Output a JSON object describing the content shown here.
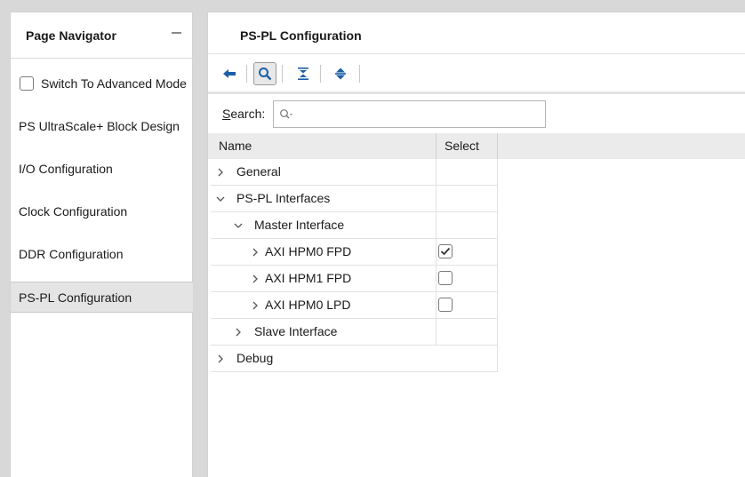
{
  "navigator": {
    "title": "Page Navigator",
    "advanced_mode_label": "Switch To Advanced Mode",
    "advanced_mode_checked": false,
    "items": [
      {
        "label": "PS UltraScale+ Block Design",
        "selected": false
      },
      {
        "label": "I/O Configuration",
        "selected": false
      },
      {
        "label": "Clock Configuration",
        "selected": false
      },
      {
        "label": "DDR Configuration",
        "selected": false
      },
      {
        "label": "PS-PL Configuration",
        "selected": true
      }
    ]
  },
  "main": {
    "title": "PS-PL Configuration",
    "toolbar": {
      "icons": [
        "back-arrow-icon",
        "search-icon",
        "collapse-all-icon",
        "expand-all-icon"
      ]
    },
    "search": {
      "label": "Search:",
      "value": "",
      "placeholder": ""
    },
    "table": {
      "columns": [
        "Name",
        "Select"
      ],
      "rows": [
        {
          "label": "General",
          "level": 0,
          "expanded": false,
          "has_checkbox": false
        },
        {
          "label": "PS-PL Interfaces",
          "level": 0,
          "expanded": true,
          "has_checkbox": false
        },
        {
          "label": "Master Interface",
          "level": 1,
          "expanded": true,
          "has_checkbox": false
        },
        {
          "label": "AXI HPM0 FPD",
          "level": 2,
          "expanded": false,
          "has_checkbox": true,
          "checked": true
        },
        {
          "label": "AXI HPM1 FPD",
          "level": 2,
          "expanded": false,
          "has_checkbox": true,
          "checked": false
        },
        {
          "label": "AXI HPM0 LPD",
          "level": 2,
          "expanded": false,
          "has_checkbox": true,
          "checked": false
        },
        {
          "label": "Slave Interface",
          "level": 1,
          "expanded": false,
          "has_checkbox": false
        },
        {
          "label": "Debug",
          "level": 0,
          "expanded": false,
          "has_checkbox": false
        }
      ]
    }
  },
  "colors": {
    "accent_blue": "#1d5fa6",
    "selected_bg": "#e4e4e4",
    "header_bg": "#ebebeb"
  }
}
